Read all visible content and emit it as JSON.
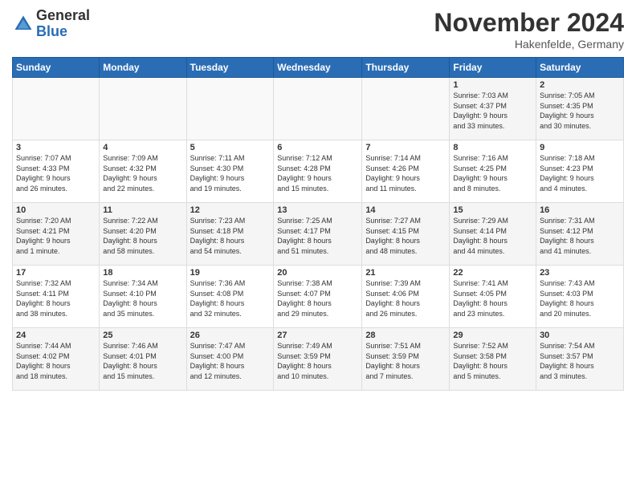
{
  "logo": {
    "general": "General",
    "blue": "Blue"
  },
  "header": {
    "month_title": "November 2024",
    "location": "Hakenfelde, Germany"
  },
  "days_of_week": [
    "Sunday",
    "Monday",
    "Tuesday",
    "Wednesday",
    "Thursday",
    "Friday",
    "Saturday"
  ],
  "weeks": [
    [
      {
        "day": "",
        "info": ""
      },
      {
        "day": "",
        "info": ""
      },
      {
        "day": "",
        "info": ""
      },
      {
        "day": "",
        "info": ""
      },
      {
        "day": "",
        "info": ""
      },
      {
        "day": "1",
        "info": "Sunrise: 7:03 AM\nSunset: 4:37 PM\nDaylight: 9 hours\nand 33 minutes."
      },
      {
        "day": "2",
        "info": "Sunrise: 7:05 AM\nSunset: 4:35 PM\nDaylight: 9 hours\nand 30 minutes."
      }
    ],
    [
      {
        "day": "3",
        "info": "Sunrise: 7:07 AM\nSunset: 4:33 PM\nDaylight: 9 hours\nand 26 minutes."
      },
      {
        "day": "4",
        "info": "Sunrise: 7:09 AM\nSunset: 4:32 PM\nDaylight: 9 hours\nand 22 minutes."
      },
      {
        "day": "5",
        "info": "Sunrise: 7:11 AM\nSunset: 4:30 PM\nDaylight: 9 hours\nand 19 minutes."
      },
      {
        "day": "6",
        "info": "Sunrise: 7:12 AM\nSunset: 4:28 PM\nDaylight: 9 hours\nand 15 minutes."
      },
      {
        "day": "7",
        "info": "Sunrise: 7:14 AM\nSunset: 4:26 PM\nDaylight: 9 hours\nand 11 minutes."
      },
      {
        "day": "8",
        "info": "Sunrise: 7:16 AM\nSunset: 4:25 PM\nDaylight: 9 hours\nand 8 minutes."
      },
      {
        "day": "9",
        "info": "Sunrise: 7:18 AM\nSunset: 4:23 PM\nDaylight: 9 hours\nand 4 minutes."
      }
    ],
    [
      {
        "day": "10",
        "info": "Sunrise: 7:20 AM\nSunset: 4:21 PM\nDaylight: 9 hours\nand 1 minute."
      },
      {
        "day": "11",
        "info": "Sunrise: 7:22 AM\nSunset: 4:20 PM\nDaylight: 8 hours\nand 58 minutes."
      },
      {
        "day": "12",
        "info": "Sunrise: 7:23 AM\nSunset: 4:18 PM\nDaylight: 8 hours\nand 54 minutes."
      },
      {
        "day": "13",
        "info": "Sunrise: 7:25 AM\nSunset: 4:17 PM\nDaylight: 8 hours\nand 51 minutes."
      },
      {
        "day": "14",
        "info": "Sunrise: 7:27 AM\nSunset: 4:15 PM\nDaylight: 8 hours\nand 48 minutes."
      },
      {
        "day": "15",
        "info": "Sunrise: 7:29 AM\nSunset: 4:14 PM\nDaylight: 8 hours\nand 44 minutes."
      },
      {
        "day": "16",
        "info": "Sunrise: 7:31 AM\nSunset: 4:12 PM\nDaylight: 8 hours\nand 41 minutes."
      }
    ],
    [
      {
        "day": "17",
        "info": "Sunrise: 7:32 AM\nSunset: 4:11 PM\nDaylight: 8 hours\nand 38 minutes."
      },
      {
        "day": "18",
        "info": "Sunrise: 7:34 AM\nSunset: 4:10 PM\nDaylight: 8 hours\nand 35 minutes."
      },
      {
        "day": "19",
        "info": "Sunrise: 7:36 AM\nSunset: 4:08 PM\nDaylight: 8 hours\nand 32 minutes."
      },
      {
        "day": "20",
        "info": "Sunrise: 7:38 AM\nSunset: 4:07 PM\nDaylight: 8 hours\nand 29 minutes."
      },
      {
        "day": "21",
        "info": "Sunrise: 7:39 AM\nSunset: 4:06 PM\nDaylight: 8 hours\nand 26 minutes."
      },
      {
        "day": "22",
        "info": "Sunrise: 7:41 AM\nSunset: 4:05 PM\nDaylight: 8 hours\nand 23 minutes."
      },
      {
        "day": "23",
        "info": "Sunrise: 7:43 AM\nSunset: 4:03 PM\nDaylight: 8 hours\nand 20 minutes."
      }
    ],
    [
      {
        "day": "24",
        "info": "Sunrise: 7:44 AM\nSunset: 4:02 PM\nDaylight: 8 hours\nand 18 minutes."
      },
      {
        "day": "25",
        "info": "Sunrise: 7:46 AM\nSunset: 4:01 PM\nDaylight: 8 hours\nand 15 minutes."
      },
      {
        "day": "26",
        "info": "Sunrise: 7:47 AM\nSunset: 4:00 PM\nDaylight: 8 hours\nand 12 minutes."
      },
      {
        "day": "27",
        "info": "Sunrise: 7:49 AM\nSunset: 3:59 PM\nDaylight: 8 hours\nand 10 minutes."
      },
      {
        "day": "28",
        "info": "Sunrise: 7:51 AM\nSunset: 3:59 PM\nDaylight: 8 hours\nand 7 minutes."
      },
      {
        "day": "29",
        "info": "Sunrise: 7:52 AM\nSunset: 3:58 PM\nDaylight: 8 hours\nand 5 minutes."
      },
      {
        "day": "30",
        "info": "Sunrise: 7:54 AM\nSunset: 3:57 PM\nDaylight: 8 hours\nand 3 minutes."
      }
    ]
  ]
}
